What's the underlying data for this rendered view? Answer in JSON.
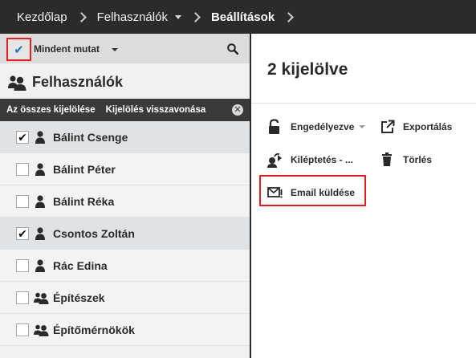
{
  "breadcrumb": {
    "items": [
      {
        "label": "Kezdőlap",
        "current": false,
        "dropdown": false
      },
      {
        "label": "Felhasználók",
        "current": false,
        "dropdown": true
      },
      {
        "label": "Beállítások",
        "current": true,
        "dropdown": false
      }
    ]
  },
  "left_panel": {
    "select_toggle_icon": "checkmark-icon",
    "filter_label": "Mindent mutat",
    "search_icon": "search-icon",
    "section_title": "Felhasználók",
    "select_all_label": "Az összes kijelölése",
    "deselect_label": "Kijelölés visszavonása",
    "users": [
      {
        "name": "Bálint Csenge",
        "checked": true,
        "type": "user"
      },
      {
        "name": "Bálint Péter",
        "checked": false,
        "type": "user"
      },
      {
        "name": "Bálint Réka",
        "checked": false,
        "type": "user"
      },
      {
        "name": "Csontos Zoltán",
        "checked": true,
        "type": "user"
      },
      {
        "name": "Rác Edina",
        "checked": false,
        "type": "user"
      },
      {
        "name": "Építészek",
        "checked": false,
        "type": "group"
      },
      {
        "name": "Építőmérnökök",
        "checked": false,
        "type": "group"
      }
    ]
  },
  "right_panel": {
    "selection_title": "2 kijelölve",
    "actions": {
      "enabled_label": "Engedélyezve",
      "export_label": "Exportálás",
      "logout_label": "Kiléptetés - ...",
      "delete_label": "Törlés",
      "email_label": "Email küldése"
    }
  },
  "colors": {
    "topbar": "#2b2b2b",
    "panel": "#f1f1f1",
    "selected_row": "#dfe3e6",
    "highlight": "#e02020",
    "check_accent": "#2a6fb8"
  }
}
